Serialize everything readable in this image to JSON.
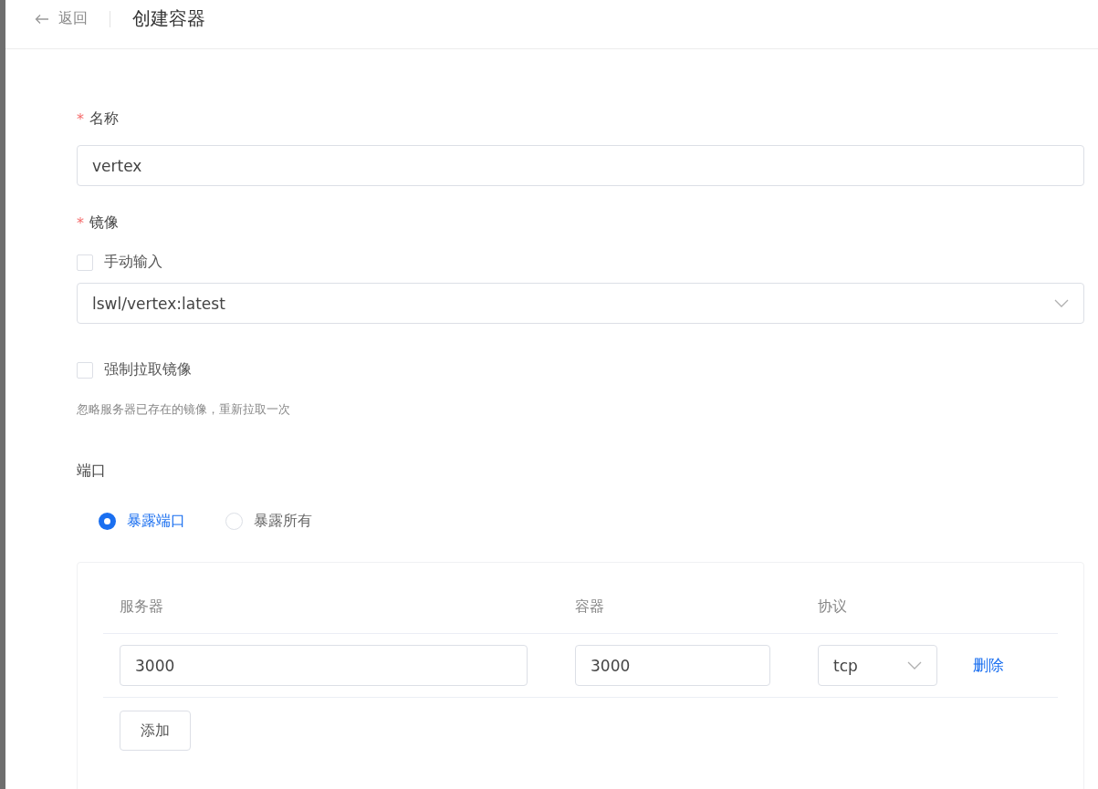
{
  "header": {
    "back_label": "返回",
    "title": "创建容器"
  },
  "name_field": {
    "required_mark": "*",
    "label": "名称",
    "value": "vertex"
  },
  "image_field": {
    "required_mark": "*",
    "label": "镜像",
    "manual_input": {
      "label": "手动输入",
      "checked": false
    },
    "value": "lswl/vertex:latest"
  },
  "force_pull": {
    "label": "强制拉取镜像",
    "checked": false,
    "hint": "忽略服务器已存在的镜像，重新拉取一次"
  },
  "ports": {
    "label": "端口",
    "options": [
      {
        "label": "暴露端口",
        "selected": true
      },
      {
        "label": "暴露所有",
        "selected": false
      }
    ],
    "columns": [
      "服务器",
      "容器",
      "协议"
    ],
    "rows": [
      {
        "server": "3000",
        "container": "3000",
        "protocol": "tcp",
        "delete_label": "删除"
      }
    ],
    "add_label": "添加"
  }
}
